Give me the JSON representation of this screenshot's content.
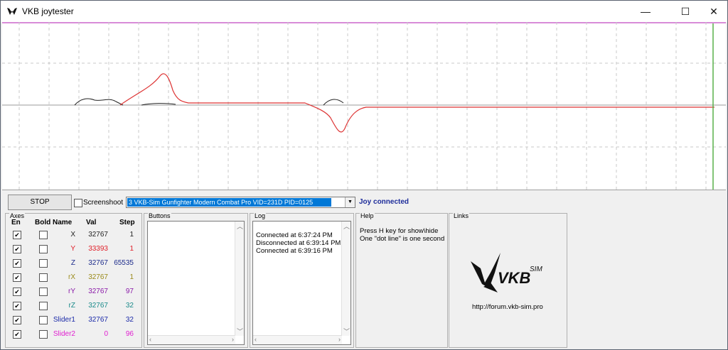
{
  "window": {
    "title": "VKB joytester",
    "minimize": "—",
    "maximize": "☐",
    "close": "✕"
  },
  "graph": {
    "grid": true,
    "series_colors": {
      "red": "#dd3333",
      "black": "#222222",
      "cursor": "#59b04a",
      "top_line": "#cc66cc"
    }
  },
  "controls": {
    "stop_label": "STOP",
    "screenshot_label": "Screenshoot",
    "screenshot_checked": false,
    "device_selected": "3  VKB-Sim Gunfighter Modern Combat Pro  VID=231D PID=0125",
    "status": "Joy connected"
  },
  "axes": {
    "title": "Axes",
    "headers": {
      "en": "En",
      "bold": "Bold",
      "name": "Name",
      "val": "Val",
      "step": "Step"
    },
    "rows": [
      {
        "name": "X",
        "val": "32767",
        "step": "1",
        "color": "#222222"
      },
      {
        "name": "Y",
        "val": "33393",
        "step": "1",
        "color": "#e0202a"
      },
      {
        "name": "Z",
        "val": "32767",
        "step": "65535",
        "color": "#1b2a8a"
      },
      {
        "name": "rX",
        "val": "32767",
        "step": "1",
        "color": "#9a8a1a"
      },
      {
        "name": "rY",
        "val": "32767",
        "step": "97",
        "color": "#8a1aa8"
      },
      {
        "name": "rZ",
        "val": "32767",
        "step": "32",
        "color": "#1a8a8a"
      },
      {
        "name": "Slider1",
        "val": "32767",
        "step": "32",
        "color": "#1b2aa8"
      },
      {
        "name": "Slider2",
        "val": "0",
        "step": "96",
        "color": "#e020d0"
      }
    ]
  },
  "buttons": {
    "title": "Buttons"
  },
  "log": {
    "title": "Log",
    "lines": [
      "Connected at 6:37:24 PM",
      "Disconnected at 6:39:14 PM",
      "Connected at 6:39:16 PM"
    ]
  },
  "help": {
    "title": "Help",
    "lines": [
      "Press H key for show\\hide",
      "One \"dot line\" is one second"
    ]
  },
  "links": {
    "title": "Links",
    "logo_text": "VKB",
    "logo_sub": "SIM",
    "url": "http://forum.vkb-sim.pro"
  }
}
